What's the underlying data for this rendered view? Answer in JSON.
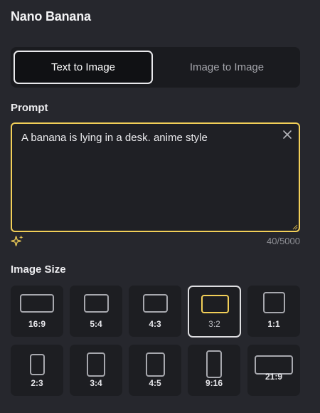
{
  "app": {
    "title": "Nano Banana"
  },
  "mode_tabs": [
    {
      "label": "Text to Image",
      "active": true
    },
    {
      "label": "Image to Image",
      "active": false
    }
  ],
  "prompt": {
    "label": "Prompt",
    "value": "A banana is lying in a desk. anime style",
    "counter": "40/5000"
  },
  "image_size": {
    "label": "Image Size",
    "selected": "3:2",
    "options": [
      {
        "ratio": "16:9"
      },
      {
        "ratio": "5:4"
      },
      {
        "ratio": "4:3"
      },
      {
        "ratio": "3:2"
      },
      {
        "ratio": "1:1"
      },
      {
        "ratio": "2:3"
      },
      {
        "ratio": "3:4"
      },
      {
        "ratio": "4:5"
      },
      {
        "ratio": "9:16"
      },
      {
        "ratio": "21:9"
      }
    ]
  },
  "colors": {
    "accent": "#f2cf58",
    "background": "#26272d",
    "card": "#1d1e22"
  },
  "icons": {
    "clear": "close-icon",
    "enhance": "sparkle-icon"
  }
}
